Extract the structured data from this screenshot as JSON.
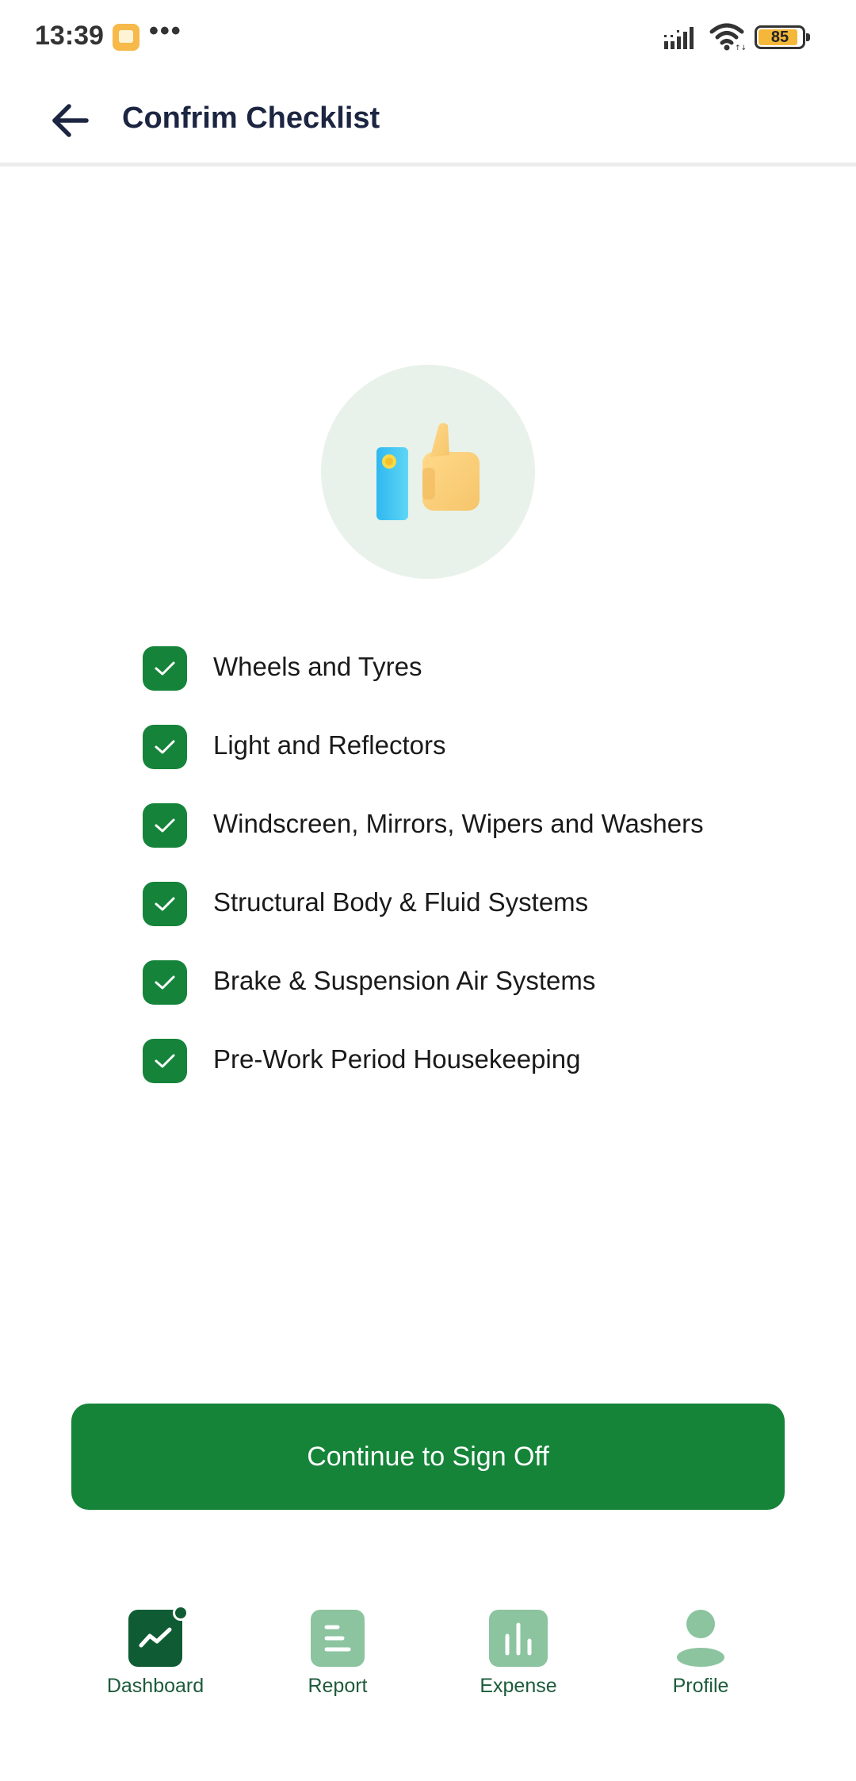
{
  "status_bar": {
    "time": "13:39",
    "dots": "•••",
    "battery_level": "85",
    "icons": [
      "app-notification-icon",
      "signal-icon",
      "wifi-icon",
      "battery-icon"
    ]
  },
  "header": {
    "title": "Confrim Checklist",
    "back_icon": "arrow-left-icon"
  },
  "hero": {
    "icon": "thumbs-up-icon"
  },
  "checklist": {
    "items": [
      {
        "label": "Wheels and Tyres",
        "checked": true
      },
      {
        "label": "Light and Reflectors",
        "checked": true
      },
      {
        "label": "Windscreen, Mirrors, Wipers and Washers",
        "checked": true
      },
      {
        "label": "Structural Body & Fluid Systems",
        "checked": true
      },
      {
        "label": "Brake & Suspension Air Systems",
        "checked": true
      },
      {
        "label": "Pre-Work Period Housekeeping",
        "checked": true
      }
    ]
  },
  "cta": {
    "label": "Continue to Sign Off"
  },
  "bottom_nav": {
    "items": [
      {
        "label": "Dashboard",
        "icon": "dashboard-chart-icon",
        "active": true
      },
      {
        "label": "Report",
        "icon": "report-icon",
        "active": false
      },
      {
        "label": "Expense",
        "icon": "expense-bars-icon",
        "active": false
      },
      {
        "label": "Profile",
        "icon": "profile-person-icon",
        "active": false
      }
    ]
  },
  "colors": {
    "primary_green": "#158438",
    "active_nav": "#0f5c34",
    "inactive_nav": "#8cc4a0",
    "hero_bg": "#e8f2ea",
    "title_text": "#1c2541"
  }
}
